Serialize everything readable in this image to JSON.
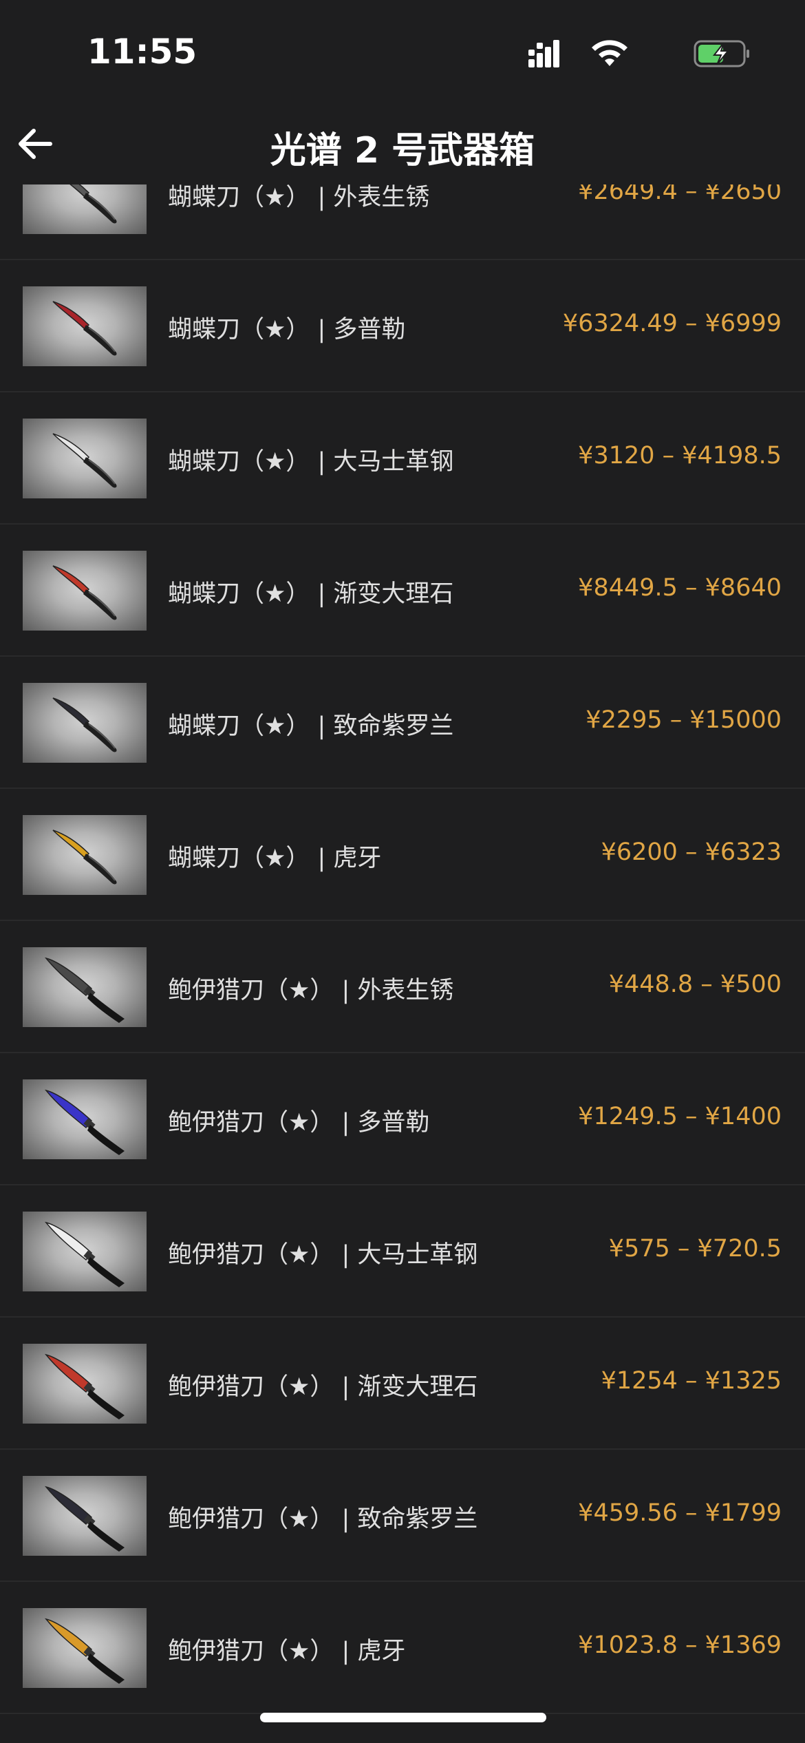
{
  "status": {
    "time": "11:55",
    "icons": [
      "signal-icon",
      "wifi-icon",
      "battery-charging-icon"
    ]
  },
  "nav": {
    "back_icon": "arrow-left-icon",
    "title": "光谱 2 号武器箱"
  },
  "colors": {
    "background": "#1e1e1f",
    "price": "#e1a645",
    "text": "#e0e0e0",
    "battery": "#5fd068"
  },
  "items": [
    {
      "name": "蝴蝶刀（★） | 外表生锈",
      "price": "¥2649.4 – ¥2650",
      "knife": "butterfly",
      "blade_color": "#5a5a5a"
    },
    {
      "name": "蝴蝶刀（★） | 多普勒",
      "price": "¥6324.49 – ¥6999",
      "knife": "butterfly",
      "blade_color": "#a8242a"
    },
    {
      "name": "蝴蝶刀（★） | 大马士革钢",
      "price": "¥3120 – ¥4198.5",
      "knife": "butterfly",
      "blade_color": "#e6e6e6"
    },
    {
      "name": "蝴蝶刀（★） | 渐变大理石",
      "price": "¥8449.5 – ¥8640",
      "knife": "butterfly",
      "blade_color": "#c0392b"
    },
    {
      "name": "蝴蝶刀（★） | 致命紫罗兰",
      "price": "¥2295 – ¥15000",
      "knife": "butterfly",
      "blade_color": "#2c2c34"
    },
    {
      "name": "蝴蝶刀（★） | 虎牙",
      "price": "¥6200 – ¥6323",
      "knife": "butterfly",
      "blade_color": "#d9a020"
    },
    {
      "name": "鲍伊猎刀（★） | 外表生锈",
      "price": "¥448.8 – ¥500",
      "knife": "bowie",
      "blade_color": "#4a4a4a"
    },
    {
      "name": "鲍伊猎刀（★） | 多普勒",
      "price": "¥1249.5 – ¥1400",
      "knife": "bowie",
      "blade_color": "#3a34c8"
    },
    {
      "name": "鲍伊猎刀（★） | 大马士革钢",
      "price": "¥575 – ¥720.5",
      "knife": "bowie",
      "blade_color": "#eeeeee"
    },
    {
      "name": "鲍伊猎刀（★） | 渐变大理石",
      "price": "¥1254 – ¥1325",
      "knife": "bowie",
      "blade_color": "#c0392b"
    },
    {
      "name": "鲍伊猎刀（★） | 致命紫罗兰",
      "price": "¥459.56 – ¥1799",
      "knife": "bowie",
      "blade_color": "#2b2b36"
    },
    {
      "name": "鲍伊猎刀（★） | 虎牙",
      "price": "¥1023.8 – ¥1369",
      "knife": "bowie",
      "blade_color": "#d99a2a"
    }
  ]
}
